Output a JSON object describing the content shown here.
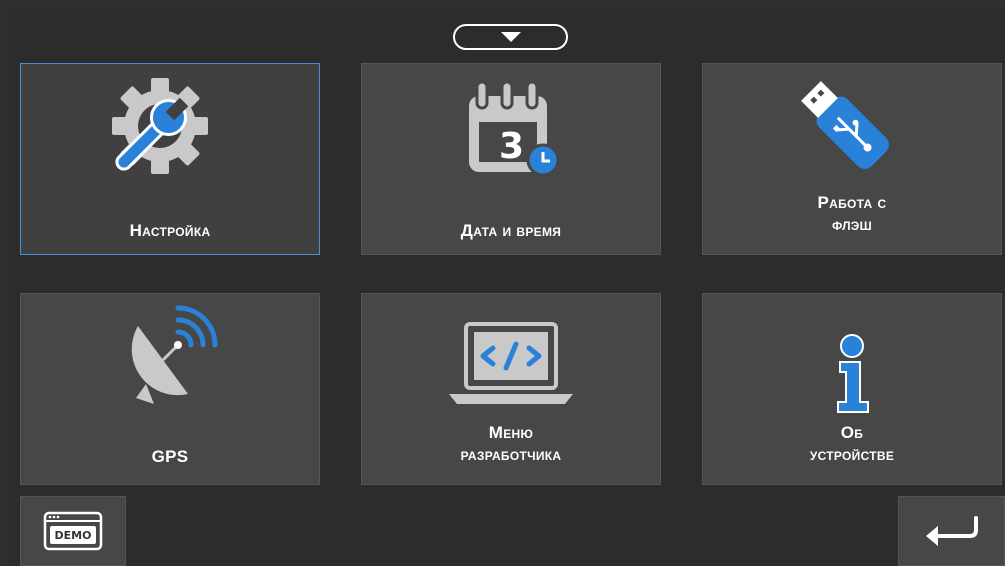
{
  "tiles": [
    {
      "label": "Настройка",
      "icon": "settings-wrench-icon"
    },
    {
      "label": "Дата и время",
      "icon": "calendar-clock-icon"
    },
    {
      "label": "Работа с\nфлэш",
      "icon": "usb-flash-icon"
    },
    {
      "label": "GPS",
      "icon": "satellite-dish-icon"
    },
    {
      "label": "Меню\nразработчика",
      "icon": "laptop-code-icon"
    },
    {
      "label": "Об\nустройстве",
      "icon": "info-icon"
    }
  ],
  "calendar_day": "3",
  "demo_label": "DEMO",
  "colors": {
    "accent": "#2a82d8",
    "icon_gray": "#c9c9c9",
    "tile": "#474747",
    "background": "#2c2c2c"
  }
}
